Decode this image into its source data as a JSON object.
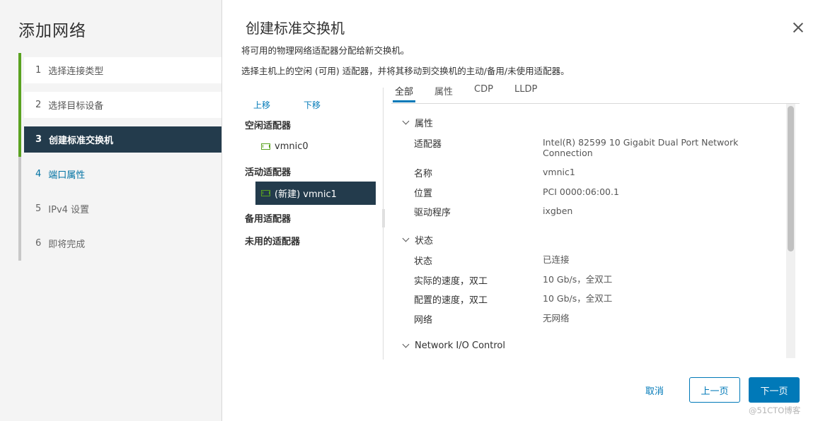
{
  "wizard": {
    "title": "添加网络",
    "steps": [
      {
        "num": "1",
        "label": "选择连接类型"
      },
      {
        "num": "2",
        "label": "选择目标设备"
      },
      {
        "num": "3",
        "label": "创建标准交换机"
      },
      {
        "num": "4",
        "label": "端口属性"
      },
      {
        "num": "5",
        "label": "IPv4 设置"
      },
      {
        "num": "6",
        "label": "即将完成"
      }
    ]
  },
  "header": {
    "title": "创建标准交换机",
    "desc1": "将可用的物理网络适配器分配给新交换机。",
    "desc2": "选择主机上的空闲 (可用) 适配器，并将其移动到交换机的主动/备用/未使用适配器。"
  },
  "adapters": {
    "move_up": "上移",
    "move_down": "下移",
    "groups": [
      {
        "label": "空闲适配器",
        "items": [
          "vmnic0"
        ]
      },
      {
        "label": "活动适配器",
        "items": [
          "(新建) vmnic1"
        ]
      },
      {
        "label": "备用适配器",
        "items": []
      },
      {
        "label": "未用的适配器",
        "items": []
      }
    ]
  },
  "tabs": [
    "全部",
    "属性",
    "CDP",
    "LLDP"
  ],
  "details": {
    "properties": {
      "title": "属性",
      "rows": [
        {
          "key": "适配器",
          "value": "Intel(R) 82599 10 Gigabit Dual Port Network Connection"
        },
        {
          "key": "名称",
          "value": "vmnic1"
        },
        {
          "key": "位置",
          "value": "PCI 0000:06:00.1"
        },
        {
          "key": "驱动程序",
          "value": "ixgben"
        }
      ]
    },
    "status": {
      "title": "状态",
      "rows": [
        {
          "key": "状态",
          "value": "已连接"
        },
        {
          "key": "实际的速度，双工",
          "value": "10 Gb/s，全双工"
        },
        {
          "key": "配置的速度，双工",
          "value": "10 Gb/s，全双工"
        },
        {
          "key": "网络",
          "value": "无网络"
        }
      ]
    },
    "nioc": {
      "title": "Network I/O Control"
    }
  },
  "footer": {
    "cancel": "取消",
    "back": "上一页",
    "next": "下一页"
  },
  "watermark": "@51CTO博客",
  "colors": {
    "accent": "#0079b8",
    "selected_bg": "#233b4c",
    "success": "#5aa220"
  }
}
